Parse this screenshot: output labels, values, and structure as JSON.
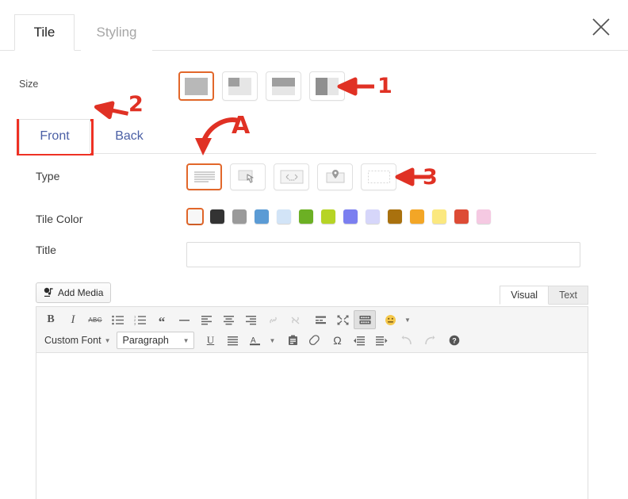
{
  "window": {
    "close_icon": "close-x-icon"
  },
  "tabs": [
    {
      "label": "Tile",
      "active": true
    },
    {
      "label": "Styling",
      "active": false
    }
  ],
  "size_row": {
    "label": "Size",
    "options": [
      {
        "name": "size-full",
        "glyph": "full",
        "selected": true
      },
      {
        "name": "size-quarter",
        "glyph": "quarter",
        "selected": false
      },
      {
        "name": "size-half-top",
        "glyph": "half-top",
        "selected": false
      },
      {
        "name": "size-half-left",
        "glyph": "half-left",
        "selected": false
      }
    ]
  },
  "side_tabs": [
    {
      "label": "Front",
      "active": true
    },
    {
      "label": "Back",
      "active": false
    }
  ],
  "type_row": {
    "label": "Type",
    "options": [
      {
        "name": "type-text",
        "icon": "text-lines-icon",
        "selected": true
      },
      {
        "name": "type-button",
        "icon": "click-hand-icon",
        "selected": false
      },
      {
        "name": "type-slider",
        "icon": "carousel-icon",
        "selected": false
      },
      {
        "name": "type-map",
        "icon": "map-pin-icon",
        "selected": false
      },
      {
        "name": "type-blank",
        "icon": "blank-dashed-icon",
        "selected": false
      }
    ]
  },
  "color_row": {
    "label": "Tile Color",
    "swatches": [
      {
        "name": "color-white",
        "hex": "#f7f7f7",
        "selected": true
      },
      {
        "name": "color-black",
        "hex": "#333333",
        "selected": false
      },
      {
        "name": "color-gray",
        "hex": "#9a9a9a",
        "selected": false
      },
      {
        "name": "color-blue",
        "hex": "#5b9bd5",
        "selected": false
      },
      {
        "name": "color-light-blue",
        "hex": "#d2e4f7",
        "selected": false
      },
      {
        "name": "color-green",
        "hex": "#6cb024",
        "selected": false
      },
      {
        "name": "color-lime",
        "hex": "#b6d425",
        "selected": false
      },
      {
        "name": "color-periwinkle",
        "hex": "#7b7ff0",
        "selected": false
      },
      {
        "name": "color-lavender",
        "hex": "#d6d6fa",
        "selected": false
      },
      {
        "name": "color-brown",
        "hex": "#a9710e",
        "selected": false
      },
      {
        "name": "color-orange",
        "hex": "#f3a626",
        "selected": false
      },
      {
        "name": "color-yellow",
        "hex": "#fbe87f",
        "selected": false
      },
      {
        "name": "color-red",
        "hex": "#dd4b35",
        "selected": false
      },
      {
        "name": "color-pink",
        "hex": "#f5c9e2",
        "selected": false
      }
    ]
  },
  "title_row": {
    "label": "Title",
    "value": "",
    "placeholder": ""
  },
  "editor": {
    "add_media_label": "Add Media",
    "add_media_icon": "camera-music-icon",
    "view_tabs": [
      {
        "label": "Visual",
        "active": true
      },
      {
        "label": "Text",
        "active": false
      }
    ],
    "toolbar_row1": [
      {
        "name": "bold-button",
        "icon": "bold-icon",
        "state": "normal"
      },
      {
        "name": "italic-button",
        "icon": "italic-icon",
        "state": "normal"
      },
      {
        "name": "strikethrough-button",
        "icon": "strikethrough-icon",
        "state": "normal"
      },
      {
        "name": "bullet-list-button",
        "icon": "bullet-list-icon",
        "state": "normal"
      },
      {
        "name": "numbered-list-button",
        "icon": "numbered-list-icon",
        "state": "normal"
      },
      {
        "name": "blockquote-button",
        "icon": "quote-icon",
        "state": "normal"
      },
      {
        "name": "horizontal-rule-button",
        "icon": "horizontal-rule-icon",
        "state": "normal"
      },
      {
        "name": "align-left-button",
        "icon": "align-left-icon",
        "state": "normal"
      },
      {
        "name": "align-center-button",
        "icon": "align-center-icon",
        "state": "normal"
      },
      {
        "name": "align-right-button",
        "icon": "align-right-icon",
        "state": "normal"
      },
      {
        "name": "insert-link-button",
        "icon": "link-icon",
        "state": "disabled"
      },
      {
        "name": "remove-link-button",
        "icon": "broken-link-icon",
        "state": "disabled"
      },
      {
        "name": "read-more-button",
        "icon": "read-more-icon",
        "state": "normal"
      },
      {
        "name": "fullscreen-button",
        "icon": "fullscreen-icon",
        "state": "normal"
      },
      {
        "name": "toggle-toolbar-button",
        "icon": "kitchen-sink-icon",
        "state": "active"
      },
      {
        "name": "emoji-button",
        "icon": "smiley-icon",
        "state": "normal"
      },
      {
        "name": "emoji-dropdown-button",
        "icon": "caret-down-icon",
        "state": "normal"
      }
    ],
    "font_button_label": "Custom Font",
    "format_select_value": "Paragraph",
    "toolbar_row2": [
      {
        "name": "underline-button",
        "icon": "underline-icon",
        "state": "normal"
      },
      {
        "name": "justify-button",
        "icon": "align-justify-icon",
        "state": "normal"
      },
      {
        "name": "text-color-button",
        "icon": "text-color-a-icon",
        "state": "normal"
      },
      {
        "name": "text-color-dropdown",
        "icon": "caret-down-icon",
        "state": "normal"
      },
      {
        "name": "paste-as-text-button",
        "icon": "clipboard-icon",
        "state": "normal"
      },
      {
        "name": "clear-formatting-button",
        "icon": "eraser-icon",
        "state": "normal"
      },
      {
        "name": "special-character-button",
        "icon": "omega-icon",
        "state": "normal"
      },
      {
        "name": "outdent-button",
        "icon": "outdent-icon",
        "state": "normal"
      },
      {
        "name": "indent-button",
        "icon": "indent-icon",
        "state": "normal"
      },
      {
        "name": "undo-button",
        "icon": "undo-arrow-icon",
        "state": "disabled"
      },
      {
        "name": "redo-button",
        "icon": "redo-arrow-icon",
        "state": "disabled"
      },
      {
        "name": "keyboard-help-button",
        "icon": "help-circle-icon",
        "state": "normal"
      }
    ],
    "content": ""
  },
  "annotations": [
    {
      "name": "annotation-1",
      "text": "1",
      "kind": "arrow-left"
    },
    {
      "name": "annotation-2",
      "text": "2",
      "kind": "arrow-left-down"
    },
    {
      "name": "annotation-3",
      "text": "3",
      "kind": "arrow-left"
    },
    {
      "name": "annotation-a",
      "text": "A",
      "kind": "curved-arrow-down"
    }
  ],
  "accent": {
    "selected_border": "#e2672a",
    "annotation_red": "#e03124"
  }
}
